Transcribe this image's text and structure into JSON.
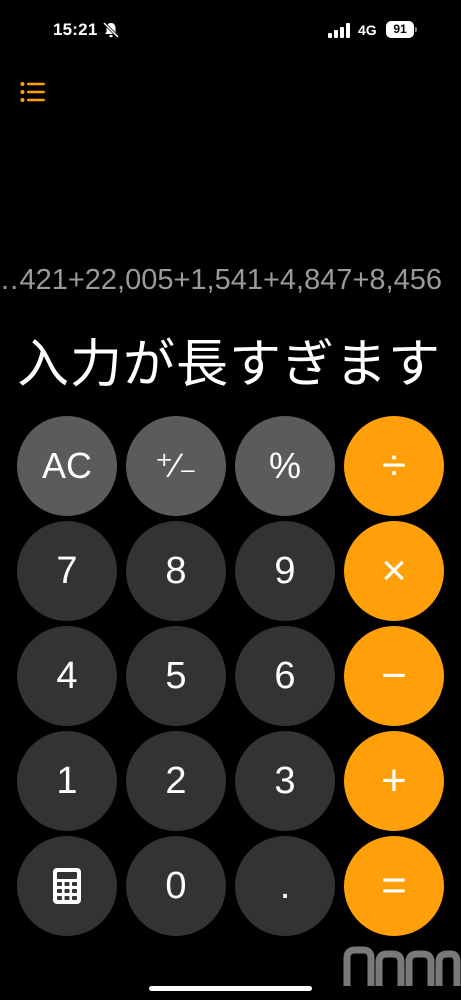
{
  "status_bar": {
    "time": "15:21",
    "network": "4G",
    "battery": "91"
  },
  "display": {
    "expression": "…421+22,005+1,541+4,847+8,456",
    "result": "入力が長すぎます"
  },
  "keys": {
    "ac": "AC",
    "plus_minus": "⁺∕₋",
    "percent": "%",
    "divide": "÷",
    "seven": "7",
    "eight": "8",
    "nine": "9",
    "multiply": "×",
    "four": "4",
    "five": "5",
    "six": "6",
    "minus": "−",
    "one": "1",
    "two": "2",
    "three": "3",
    "plus": "+",
    "zero": "0",
    "decimal": ".",
    "equals": "="
  },
  "colors": {
    "operator": "#ff9f0a",
    "function": "#5b5b5d",
    "number": "#333335",
    "background": "#000000"
  },
  "icons": [
    "bell-slash-icon",
    "signal-icon",
    "battery-icon",
    "list-icon",
    "calculator-icon"
  ]
}
